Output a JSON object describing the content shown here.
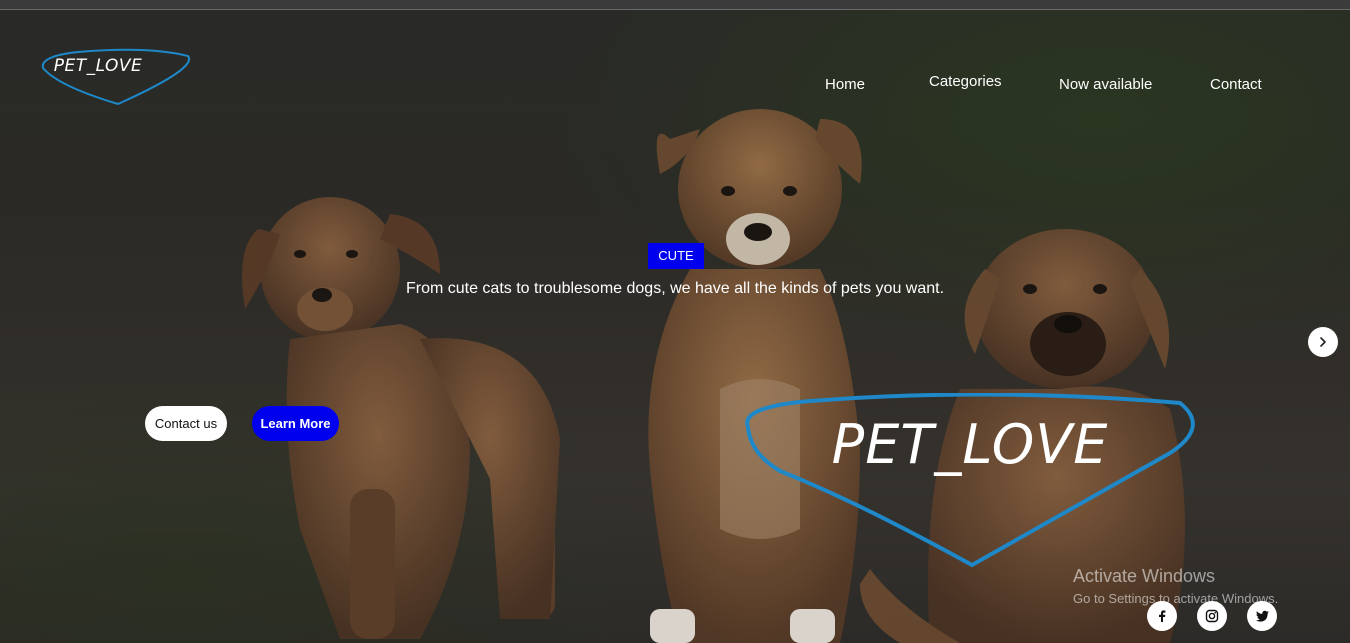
{
  "logo": {
    "small_text": "PET_LOVE",
    "big_text": "PET_LOVE",
    "color": "#1e88c8"
  },
  "nav": {
    "items": [
      {
        "label": "Home"
      },
      {
        "label": "Categories"
      },
      {
        "label": "Now available"
      },
      {
        "label": "Contact"
      }
    ]
  },
  "hero": {
    "badge": "CUTE",
    "tagline": "From cute cats to troublesome dogs, we have all the kinds of pets you want.",
    "contact_button": "Contact us",
    "learn_button": "Learn More",
    "next_icon": "chevron-right-icon"
  },
  "social": {
    "icons": [
      "facebook-icon",
      "instagram-icon",
      "twitter-icon"
    ]
  },
  "watermark": {
    "title": "Activate Windows",
    "subtitle": "Go to Settings to activate Windows."
  },
  "colors": {
    "accent": "#0000ee",
    "logo_outline": "#1e88c8",
    "text": "#ffffff"
  }
}
